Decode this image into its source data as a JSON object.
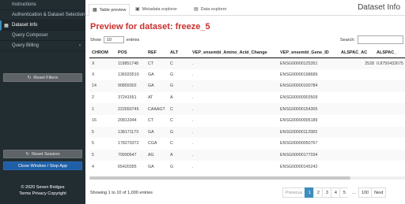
{
  "sidebar": {
    "items": [
      {
        "label": "Instructions",
        "icon": "info-icon",
        "glyph": ""
      },
      {
        "label": "Authentication & Dataset Selection",
        "icon": "key-icon",
        "glyph": ""
      },
      {
        "label": "Dataset Info",
        "icon": "table-icon",
        "glyph": "▦"
      },
      {
        "label": "Query Composer",
        "icon": "search-icon",
        "glyph": ""
      },
      {
        "label": "Query Billing",
        "icon": "money-icon",
        "glyph": ""
      }
    ],
    "query_billing_chevron": "‹",
    "reset_filters_label": "Reset Filters",
    "reset_session_label": "Reset Session",
    "close_window_label": "Close Window / Stop App",
    "refresh_glyph": "↻",
    "footer": {
      "copyright": "© 2020 Seven Bridges",
      "links": [
        "Terms",
        "Privacy",
        "Copyright"
      ]
    }
  },
  "tabs": [
    {
      "label": "Table preview",
      "glyph": "▦"
    },
    {
      "label": "Metadata explorer",
      "glyph": "▣"
    },
    {
      "label": "Data explorer",
      "glyph": "▤"
    }
  ],
  "page_title": "Dataset Info",
  "preview_title": "Preview for dataset: freeze_5",
  "length": {
    "show": "Show",
    "value": "10",
    "entries": "entries"
  },
  "search": {
    "label": "Search:",
    "value": ""
  },
  "table": {
    "columns": [
      "CHROM",
      "POS",
      "REF",
      "ALT",
      "VEP_ensembl_Amino_Acid_Change",
      "VEP_ensembl_Gene_ID",
      "ALSPAC_AC",
      "ALSPAC_"
    ],
    "rows": [
      [
        "X",
        "119851748",
        "CT",
        "C",
        ".",
        "ENSG00000125351",
        "2528",
        "0.8750432675"
      ],
      [
        "X",
        "136033510",
        "GA",
        "G",
        ".",
        "ENSG00000198689",
        "",
        ""
      ],
      [
        "14",
        "90859302",
        "GA",
        "G",
        ".",
        "ENSG00000100784",
        "",
        ""
      ],
      [
        "2",
        "37241551",
        "AT",
        "A",
        ".",
        "ENSG00000003509",
        "",
        ""
      ],
      [
        "1",
        "222650745",
        "CAAAGT",
        "C",
        ".",
        "ENSG00000154305",
        "",
        ""
      ],
      [
        "16",
        "20813344",
        "CT",
        "C",
        ".",
        "ENSG00000005189",
        "",
        ""
      ],
      [
        "5",
        "138171173",
        "GA",
        "G",
        ".",
        "ENSG00000112983",
        "",
        ""
      ],
      [
        "5",
        "178270372",
        "CGA",
        "C",
        ".",
        "ENSG00000050767",
        "",
        ""
      ],
      [
        "5",
        "79990547",
        "AG",
        "A",
        ".",
        "ENSG00000177034",
        "",
        ""
      ],
      [
        "4",
        "65420395",
        "GA",
        "G",
        ".",
        "ENSG00000145242",
        "",
        ""
      ]
    ]
  },
  "info_text": "Showing 1 to 10 of 1,000 entries",
  "pagination": [
    "Previous",
    "1",
    "2",
    "3",
    "4",
    "5",
    "…",
    "100",
    "Next"
  ]
}
